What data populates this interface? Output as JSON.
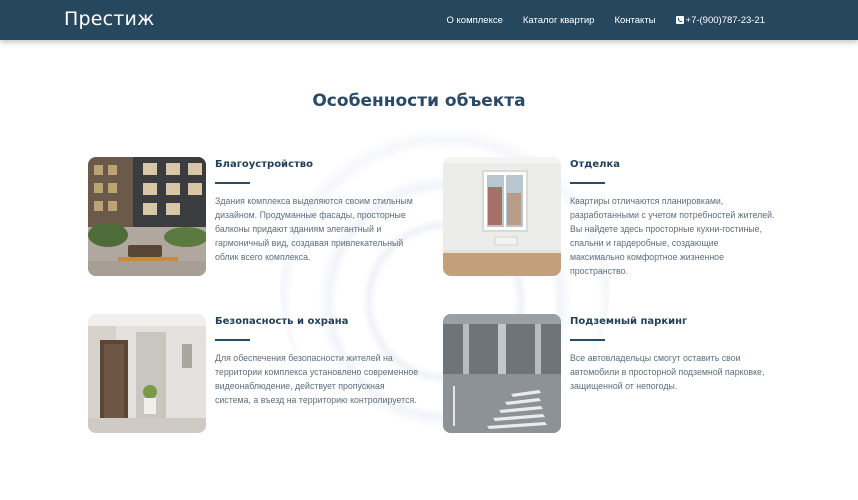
{
  "header": {
    "logo": "Престиж",
    "nav": [
      {
        "label": "О комплексе"
      },
      {
        "label": "Каталог квартир"
      },
      {
        "label": "Контакты"
      }
    ],
    "phone": "+7-(900)787-23-21",
    "phone_icon": "phone-icon",
    "color": "#27475f"
  },
  "main": {
    "title": "Особенности объекта",
    "features": [
      {
        "title": "Благоустройство",
        "description": "Здания комплекса выделяются своим стильным дизайном. Продуманные фасады, просторные балконы придают зданиям элегантный и гармоничный вид, создавая привлекательный облик всего комплекса.",
        "image": "courtyard-photo"
      },
      {
        "title": "Отделка",
        "description": "Квартиры отличаются планировками, разработанными с учетом потребностей жителей. Вы найдете здесь просторные кухни-гостиные, спальни и гардеробные, создающие максимально комфортное жизненное пространство.",
        "image": "interior-photo"
      },
      {
        "title": "Безопасность и охрана",
        "description": "Для обеспечения безопасности жителей на территории комплекса установлено современное видеонаблюдение, действует пропускная система, а въезд на территорию контролируется.",
        "image": "lobby-photo"
      },
      {
        "title": "Подземный паркинг",
        "description": "Все автовладельцы смогут оставить свои автомобили в просторной подземной парковке, защищенной от непогоды.",
        "image": "parking-photo"
      }
    ]
  }
}
